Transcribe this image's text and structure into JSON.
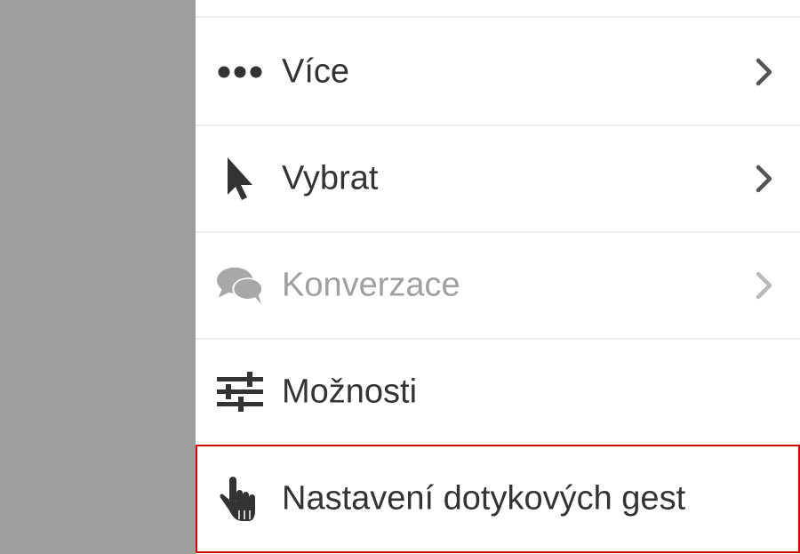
{
  "menu": {
    "items": [
      {
        "label": "Více",
        "icon": "more-dots-icon",
        "has_submenu": true,
        "enabled": true
      },
      {
        "label": "Vybrat",
        "icon": "pointer-arrow-icon",
        "has_submenu": true,
        "enabled": true
      },
      {
        "label": "Konverzace",
        "icon": "chat-bubbles-icon",
        "has_submenu": true,
        "enabled": false
      },
      {
        "label": "Možnosti",
        "icon": "sliders-icon",
        "has_submenu": false,
        "enabled": true
      },
      {
        "label": "Nastavení dotykových gest",
        "icon": "touch-hand-icon",
        "has_submenu": false,
        "enabled": true,
        "highlighted": true
      }
    ]
  },
  "colors": {
    "scrim": "#9e9e9e",
    "panel": "#ffffff",
    "text": "#333333",
    "disabled_text": "#a0a0a0",
    "icon": "#333333",
    "disabled_icon": "#a8a8a8",
    "chevron": "#555555",
    "disabled_chevron": "#b8b8b8",
    "highlight_border": "#cc0000",
    "divider": "#eeeeee"
  }
}
